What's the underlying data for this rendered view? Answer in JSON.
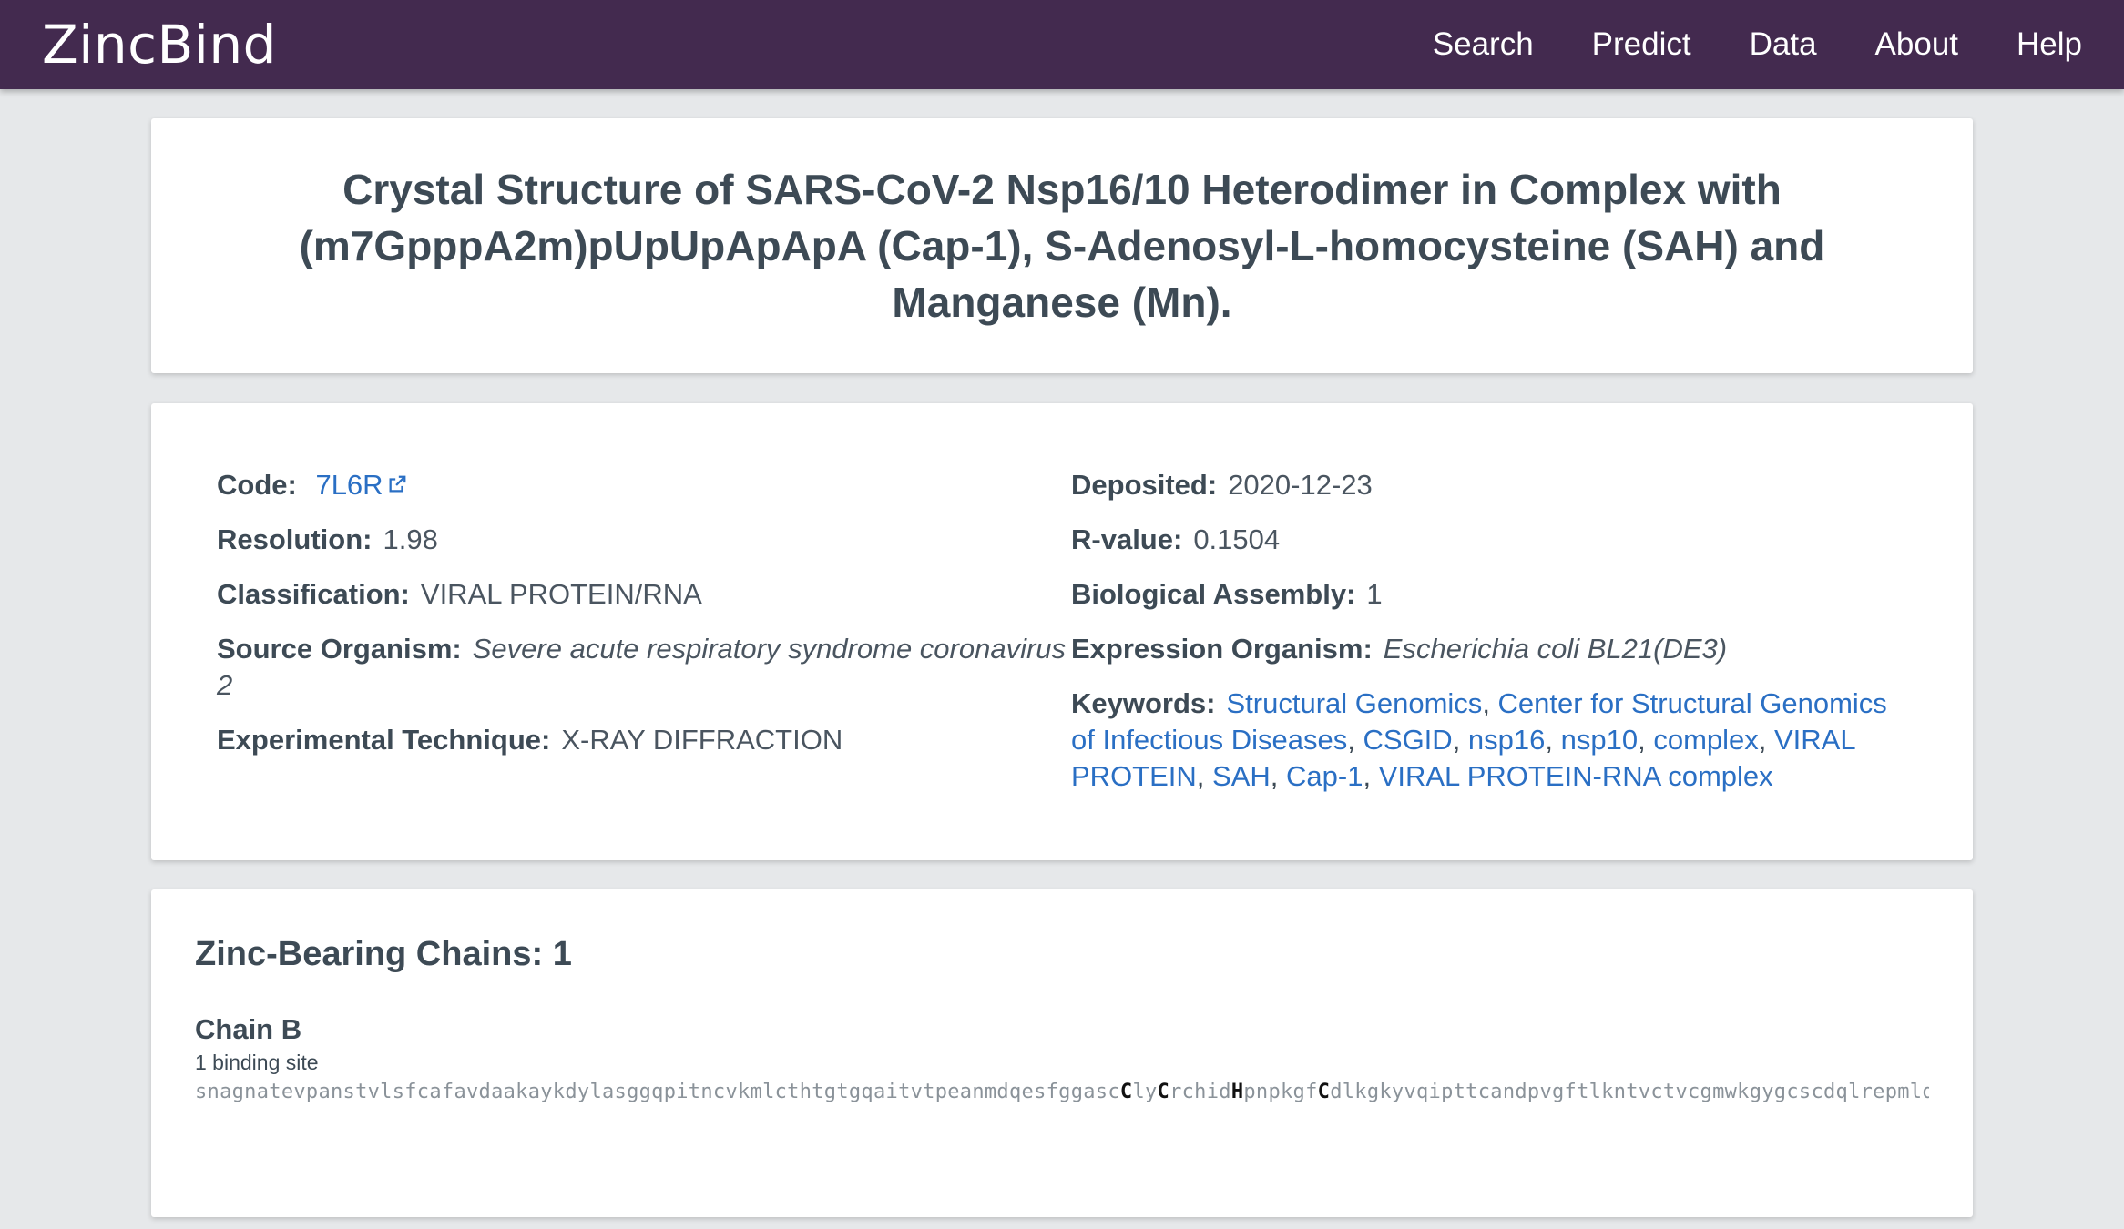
{
  "navbar": {
    "brand": "ZincBind",
    "links": [
      "Search",
      "Predict",
      "Data",
      "About",
      "Help"
    ]
  },
  "title": "Crystal Structure of SARS-CoV-2 Nsp16/10 Heterodimer in Complex with (m7GpppA2m)pUpUpApApA (Cap-1), S-Adenosyl-L-homocysteine (SAH) and Manganese (Mn).",
  "info": {
    "code_label": "Code:",
    "code": "7L6R",
    "resolution_label": "Resolution:",
    "resolution": "1.98",
    "classification_label": "Classification:",
    "classification": "VIRAL PROTEIN/RNA",
    "source_label": "Source Organism:",
    "source": "Severe acute respiratory syndrome coronavirus 2",
    "technique_label": "Experimental Technique:",
    "technique": "X-RAY DIFFRACTION",
    "deposited_label": "Deposited:",
    "deposited": "2020-12-23",
    "rvalue_label": "R-value:",
    "rvalue": "0.1504",
    "assembly_label": "Biological Assembly:",
    "assembly": "1",
    "expression_label": "Expression Organism:",
    "expression": "Escherichia coli BL21(DE3)",
    "keywords_label": "Keywords:",
    "keywords": [
      "Structural Genomics",
      "Center for Structural Genomics of Infectious Diseases",
      "CSGID",
      "nsp16",
      "nsp10",
      "complex",
      "VIRAL PROTEIN",
      "SAH",
      "Cap-1",
      "VIRAL PROTEIN-RNA complex"
    ],
    "keyword_separator": ", "
  },
  "chains": {
    "title": "Zinc-Bearing Chains: 1",
    "items": [
      {
        "name": "Chain B",
        "binding_sites": "1 binding site",
        "seq_parts": [
          {
            "text": "snagnatevpanstvlsfcafavdaakaykdylasggqpitncvkmlcthtgtgqaitvtpeanmdqesfggasc",
            "hl": false
          },
          {
            "text": "C",
            "hl": true
          },
          {
            "text": "ly",
            "hl": false
          },
          {
            "text": "C",
            "hl": true
          },
          {
            "text": "rchid",
            "hl": false
          },
          {
            "text": "H",
            "hl": true
          },
          {
            "text": "pnpkgf",
            "hl": false
          },
          {
            "text": "C",
            "hl": true
          },
          {
            "text": "dlkgkyvqipttcandpvgftlkntvctvcgmwkgygcscdqlrepmlq",
            "hl": false
          }
        ]
      }
    ]
  },
  "colors": {
    "navbar": "#432a4f",
    "link": "#2a6fc4",
    "background": "#e6e8ea"
  },
  "icons": {
    "code_link": "external-link-icon"
  }
}
